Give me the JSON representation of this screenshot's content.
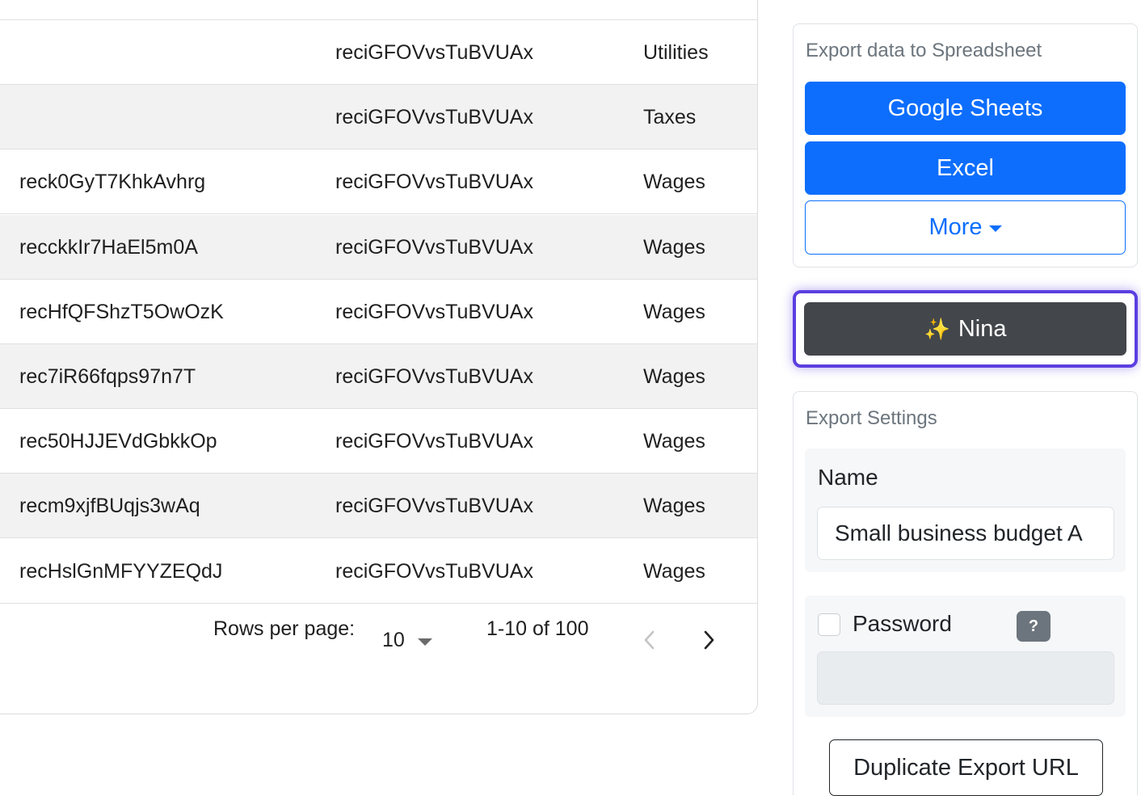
{
  "table": {
    "rows": [
      {
        "id": "",
        "ref": "reciGFOVvsTuBVUAx",
        "category": "Utilities"
      },
      {
        "id": "",
        "ref": "reciGFOVvsTuBVUAx",
        "category": "Taxes"
      },
      {
        "id": "reck0GyT7KhkAvhrg",
        "ref": "reciGFOVvsTuBVUAx",
        "category": "Wages"
      },
      {
        "id": "recckkIr7HaEl5m0A",
        "ref": "reciGFOVvsTuBVUAx",
        "category": "Wages"
      },
      {
        "id": "recHfQFShzT5OwOzK",
        "ref": "reciGFOVvsTuBVUAx",
        "category": "Wages"
      },
      {
        "id": "rec7iR66fqps97n7T",
        "ref": "reciGFOVvsTuBVUAx",
        "category": "Wages"
      },
      {
        "id": "rec50HJJEVdGbkkOp",
        "ref": "reciGFOVvsTuBVUAx",
        "category": "Wages"
      },
      {
        "id": "recm9xjfBUqjs3wAq",
        "ref": "reciGFOVvsTuBVUAx",
        "category": "Wages"
      },
      {
        "id": "recHslGnMFYYZEQdJ",
        "ref": "reciGFOVvsTuBVUAx",
        "category": "Wages"
      }
    ]
  },
  "pagination": {
    "rows_per_page_label": "Rows per page:",
    "rows_per_page_value": "10",
    "range_text": "1-10 of 100"
  },
  "export": {
    "title": "Export data to Spreadsheet",
    "google_sheets_label": "Google Sheets",
    "excel_label": "Excel",
    "more_label": "More"
  },
  "assistant": {
    "label": "Nina",
    "icon": "sparkles-icon"
  },
  "settings": {
    "title": "Export Settings",
    "name_label": "Name",
    "name_value": "Small business budget A",
    "password_label": "Password",
    "help_label": "?",
    "password_value": "",
    "duplicate_label": "Duplicate Export URL"
  },
  "colors": {
    "primary": "#0d6efd",
    "dark_button": "#43464a",
    "focus_ring": "#5b3fe0",
    "muted_text": "#6c757d"
  }
}
